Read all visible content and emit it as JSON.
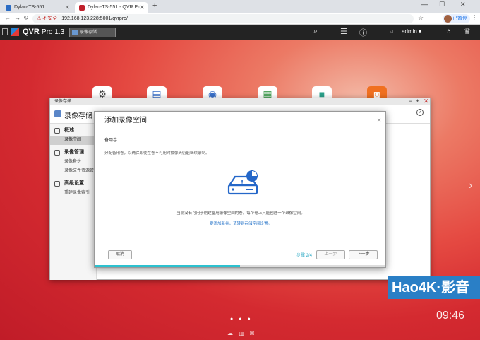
{
  "browser": {
    "tabs": [
      {
        "label": "Dylan-TS-551"
      },
      {
        "label": "Dylan-TS-551 - QVR Pro"
      }
    ],
    "new_tab": "+",
    "address": {
      "warning": "⚠ 不安全",
      "url": "192.168.123.228:5001/qvrpro/"
    },
    "profile_label": "已暂停",
    "controls": {
      "minimize": "—",
      "maximize": "☐",
      "close": "✕"
    }
  },
  "qvr": {
    "logo": "QVR",
    "product": "Pro 1.3",
    "app_tab": "录像存储",
    "user": "admin ▾"
  },
  "storage_window": {
    "title": "录像存储",
    "heading": "录像存储",
    "help": "?",
    "sidebar": [
      {
        "section": "概述",
        "items": [
          "录像空间"
        ]
      },
      {
        "section": "录像管理",
        "items": [
          "录像备份",
          "录像文件资源管理器"
        ]
      },
      {
        "section": "高级设置",
        "items": [
          "重建录像索引"
        ]
      }
    ]
  },
  "modal": {
    "title": "添加录像空间",
    "close": "×",
    "step_name": "备用卷",
    "description": "分配备用卷，以确保即使在卷不可用时摄像头仍能继续录制。",
    "message": "当前没有可用于创建备用录像空间的卷。每个卷上只能创建一个录像空间。",
    "link": "要添加新卷，请转到存储空间设置。",
    "buttons": {
      "cancel": "取消",
      "prev": "上一步",
      "next": "下一步"
    },
    "steps": "步骤 2/4",
    "progress": 0.5
  },
  "desktop": {
    "clock": "09:46",
    "watermark": "Hao4K·影音"
  },
  "colors": {
    "accent": "#2dc1cf",
    "link": "#2573c8",
    "qvr_bar": "#232323"
  }
}
